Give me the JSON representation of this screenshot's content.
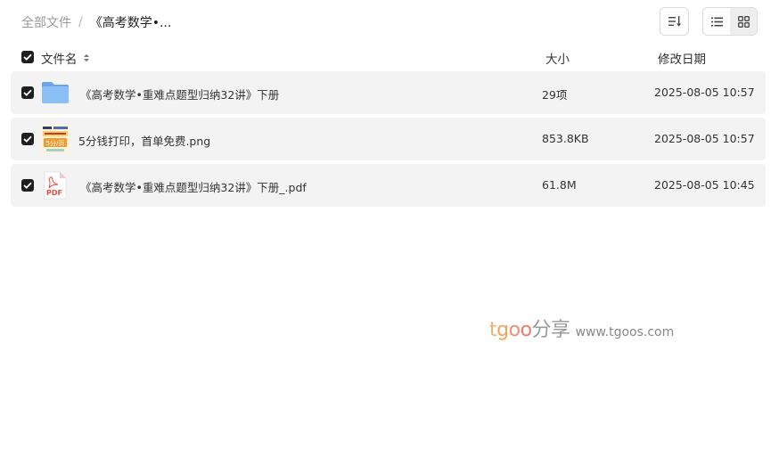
{
  "breadcrumb": {
    "root": "全部文件",
    "separator": "/",
    "current": "《高考数学•..."
  },
  "toolbar": {
    "sort_icon": "sort-lines-icon",
    "list_view_icon": "list-view-icon",
    "grid_view_icon": "grid-view-icon",
    "active_view": "list"
  },
  "columns": {
    "name": "文件名",
    "size": "大小",
    "date": "修改日期"
  },
  "files": [
    {
      "name": "《高考数学•重难点题型归纳32讲》下册",
      "size": "29项",
      "date": "2025-08-05 10:57",
      "type": "folder",
      "checked": true
    },
    {
      "name": "5分钱打印，首单免费.png",
      "size": "853.8KB",
      "date": "2025-08-05 10:57",
      "type": "image",
      "checked": true,
      "thumb_text": "5分/页"
    },
    {
      "name": "《高考数学•重难点题型归纳32讲》下册_.pdf",
      "size": "61.8M",
      "date": "2025-08-05 10:45",
      "type": "pdf",
      "checked": true,
      "icon_label": "PDF"
    }
  ],
  "watermark": {
    "brand_parts": [
      "t",
      "g",
      "o",
      "o",
      "分享"
    ],
    "url": "www.tgoos.com"
  },
  "colors": {
    "checkbox": "#1f1f1f",
    "row_bg": "#f3f3f3",
    "folder": "#7fb3ee",
    "pdf": "#e8493c",
    "wm_t": "#f3b26b",
    "wm_g": "#f0a35a",
    "wm_o1": "#ef9079",
    "wm_o2": "#f47a6e",
    "wm_share": "#999999"
  }
}
